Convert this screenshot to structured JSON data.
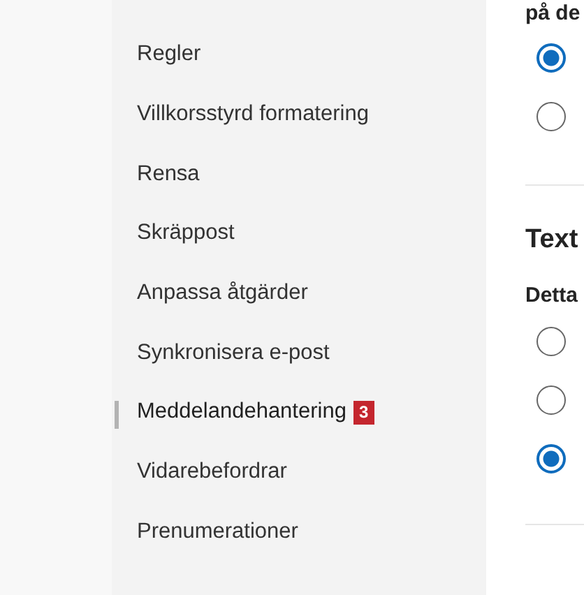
{
  "sidebar": {
    "items": [
      {
        "label": "Regler",
        "selected": false
      },
      {
        "label": "Villkorsstyrd formatering",
        "selected": false
      },
      {
        "label": "Rensa",
        "selected": false
      },
      {
        "label": "Skräppost",
        "selected": false
      },
      {
        "label": "Anpassa åtgärder",
        "selected": false
      },
      {
        "label": "Synkronisera e-post",
        "selected": false
      },
      {
        "label": "Meddelandehantering",
        "selected": true,
        "badge": "3"
      },
      {
        "label": "Vidarebefordrar",
        "selected": false
      },
      {
        "label": "Prenumerationer",
        "selected": false
      }
    ]
  },
  "content": {
    "sections": [
      {
        "subheading": "på de",
        "options": [
          {
            "selected": true
          },
          {
            "selected": false
          }
        ]
      },
      {
        "heading": "Text",
        "subheading": "Detta",
        "options": [
          {
            "selected": false
          },
          {
            "selected": false
          },
          {
            "selected": true
          }
        ]
      }
    ]
  }
}
